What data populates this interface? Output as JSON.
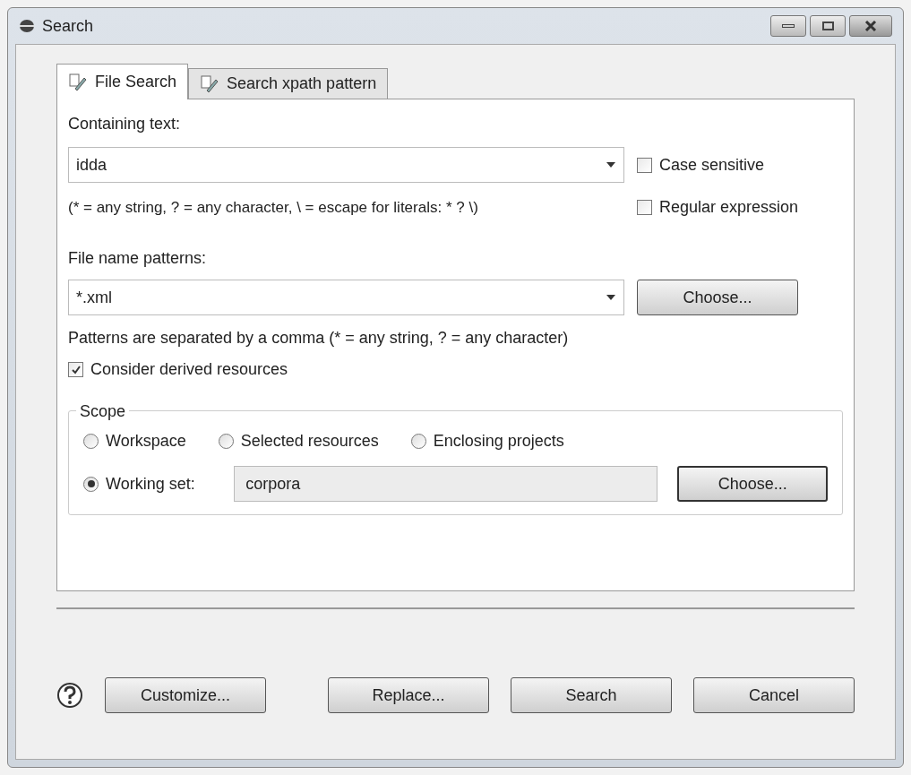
{
  "window": {
    "title": "Search"
  },
  "tabs": [
    {
      "label": "File Search",
      "selected": true
    },
    {
      "label": "Search xpath pattern",
      "selected": false
    }
  ],
  "containing_text": {
    "label": "Containing text:",
    "value": "idda",
    "hint": "(* = any string, ? = any character, \\ = escape for literals: * ? \\)"
  },
  "options": [
    {
      "label": "Case sensitive",
      "checked": false
    },
    {
      "label": "Regular expression",
      "checked": false
    }
  ],
  "file_name_patterns": {
    "label": "File name patterns:",
    "value": "*.xml",
    "choose_button": "Choose...",
    "hint": "Patterns are separated by a comma (* = any string, ? = any character)"
  },
  "derived_resources": {
    "label": "Consider derived resources",
    "checked": true
  },
  "scope": {
    "title": "Scope",
    "options": [
      {
        "label": "Workspace",
        "selected": false
      },
      {
        "label": "Selected resources",
        "selected": false
      },
      {
        "label": "Enclosing projects",
        "selected": false
      },
      {
        "label": "Working set:",
        "selected": true
      }
    ],
    "working_set": "corpora",
    "choose_button": "Choose..."
  },
  "footer": {
    "buttons": [
      "Customize...",
      "Replace...",
      "Search",
      "Cancel"
    ]
  }
}
